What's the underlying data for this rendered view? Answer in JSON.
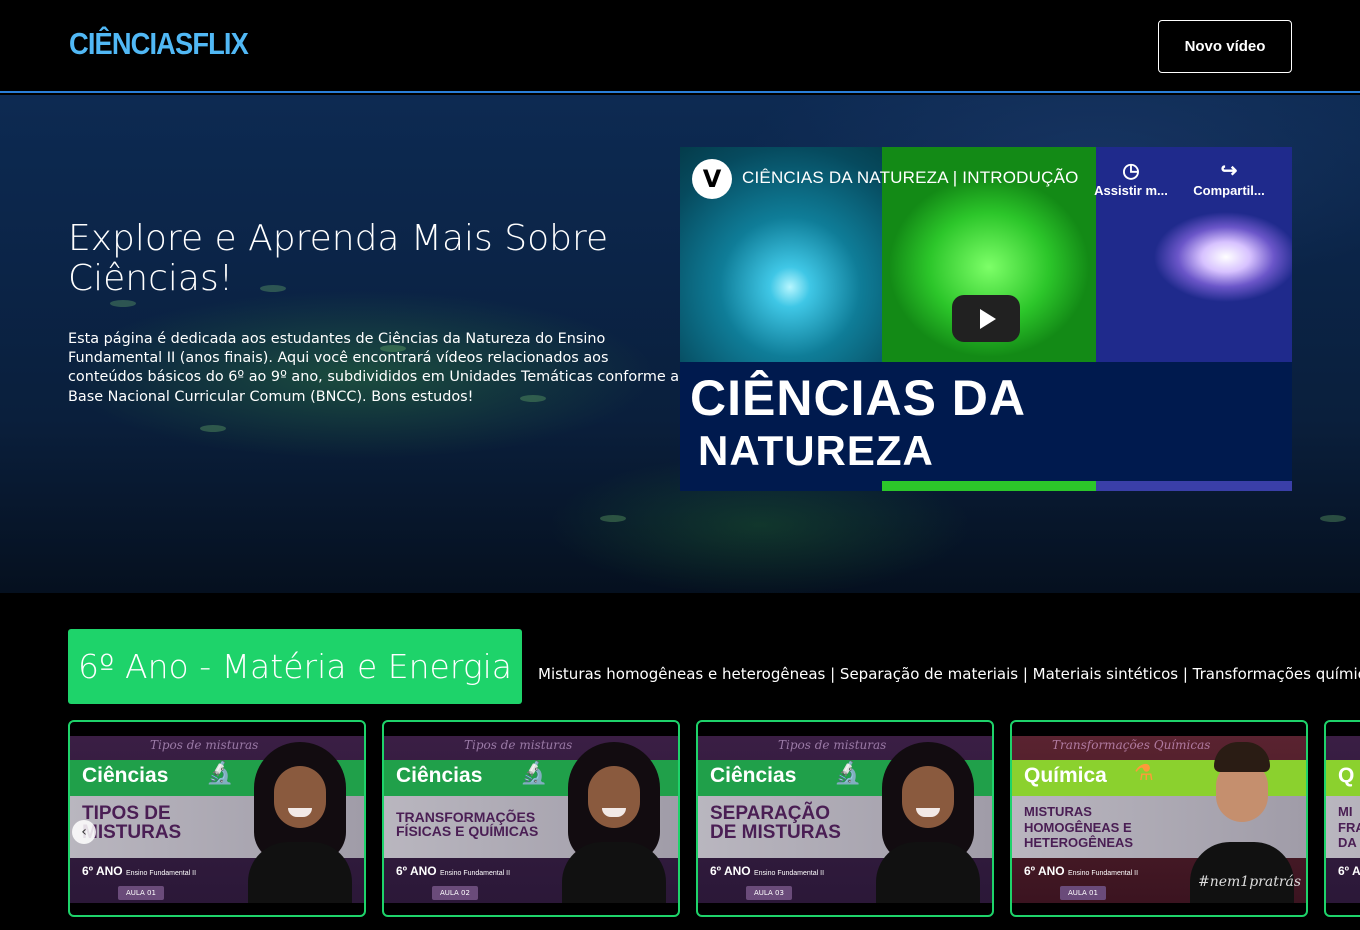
{
  "header": {
    "logo": "CIÊNCIASFLIX",
    "new_video_label": "Novo vídeo"
  },
  "hero": {
    "title": "Explore e Aprenda Mais Sobre Ciências!",
    "description": "Esta página é dedicada aos estudantes de Ciências da Natureza do Ensino Fundamental II (anos finais). Aqui você encontrará vídeos relacionados aos conteúdos básicos do 6º ao 9º ano, subdivididos em Unidades Temáticas conforme a Base Nacional Curricular Comum (BNCC). Bons estudos!"
  },
  "video": {
    "channel_logo": "V",
    "title": "CIÊNCIAS DA NATUREZA | INTRODUÇÃO",
    "watch_later": "Assistir m...",
    "share": "Compartil...",
    "overlay_line1": "CIÊNCIAS DA",
    "overlay_line2": "NATUREZA",
    "icons": [
      "clock-icon",
      "share-icon",
      "play-icon"
    ]
  },
  "section": {
    "title": "6º Ano - Matéria e Energia",
    "topics": "Misturas homogêneas e heterogêneas | Separação de materiais | Materiais sintéticos | Transformações químicas"
  },
  "cards": [
    {
      "header": "Tipos de misturas",
      "subject": "Ciências",
      "topic_line1": "TIPOS DE",
      "topic_line2": "MISTURAS",
      "grade": "6º ANO",
      "level": "Ensino Fundamental II",
      "aula": "AULA 01"
    },
    {
      "header": "Tipos de misturas",
      "subject": "Ciências",
      "topic_line1": "TRANSFORMAÇÕES",
      "topic_line2": "FÍSICAS E QUÍMICAS",
      "grade": "6º ANO",
      "level": "Ensino Fundamental II",
      "aula": "AULA 02"
    },
    {
      "header": "Tipos de misturas",
      "subject": "Ciências",
      "topic_line1": "SEPARAÇÃO",
      "topic_line2": "DE MISTURAS",
      "grade": "6º ANO",
      "level": "Ensino Fundamental II",
      "aula": "AULA 03"
    },
    {
      "header": "Transformações Químicas",
      "subject": "Química",
      "topic_line1": "MISTURAS",
      "topic_line2": "HOMOGÊNEAS E",
      "topic_line3": "HETEROGÊNEAS",
      "grade": "6º ANO",
      "level": "Ensino Fundamental II",
      "aula": "AULA 01",
      "tag": "#nem1pratrás"
    },
    {
      "subject": "Q",
      "topic_line1": "MI",
      "topic_line2": "FRA",
      "topic_line3": "DA",
      "grade": "6º A"
    }
  ],
  "colors": {
    "accent_blue": "#51b8f5",
    "section_green": "#1ed36a",
    "ciencias_band": "#20a04a",
    "quimica_band": "#8bd12e"
  }
}
